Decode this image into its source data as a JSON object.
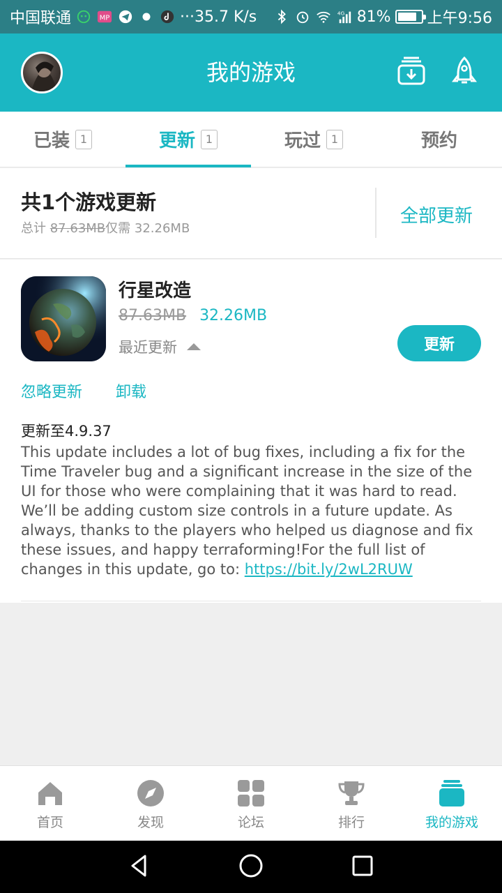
{
  "status_bar": {
    "carrier": "中国联通",
    "net_speed": "···35.7 K/s",
    "network_type": "4G",
    "battery_text": "81%",
    "battery_level": 0.81,
    "time": "上午9:56",
    "icons": [
      "wechat-icon",
      "mp-icon",
      "telegram-icon",
      "dot-icon",
      "tiktok-icon",
      "bluetooth-icon",
      "alarm-icon",
      "wifi-icon",
      "signal-icon",
      "battery-icon"
    ]
  },
  "header": {
    "title": "我的游戏",
    "accent": "#1bb7c3"
  },
  "tabs": [
    {
      "label": "已装",
      "count": "1"
    },
    {
      "label": "更新",
      "count": "1"
    },
    {
      "label": "玩过",
      "count": "1"
    },
    {
      "label": "预约",
      "count": ""
    }
  ],
  "summary": {
    "title": "共1个游戏更新",
    "total_prefix": "总计",
    "total_size": "87.63MB",
    "only_need": "仅需",
    "need_size": "32.26MB",
    "update_all": "全部更新"
  },
  "game": {
    "name": "行星改造",
    "old_size": "87.63MB",
    "new_size": "32.26MB",
    "recent_label": "最近更新",
    "update_button": "更新",
    "ignore_link": "忽略更新",
    "uninstall_link": "卸载",
    "version_line": "更新至4.9.37",
    "notes": "This update includes a lot of bug fixes, including a fix for the Time Traveler bug and a significant increase in the size of the UI for those who were complaining that it was hard to read. We’ll be adding custom size controls in a future update. As always, thanks to the players who helped us diagnose and fix these issues, and happy terraforming!For the full list of changes in this update, go to: ",
    "notes_link": "https://bit.ly/2wL2RUW"
  },
  "bottom_nav": [
    {
      "label": "首页",
      "icon": "home-icon"
    },
    {
      "label": "发现",
      "icon": "compass-icon"
    },
    {
      "label": "论坛",
      "icon": "grid-icon"
    },
    {
      "label": "排行",
      "icon": "trophy-icon"
    },
    {
      "label": "我的游戏",
      "icon": "my-games-icon"
    }
  ]
}
